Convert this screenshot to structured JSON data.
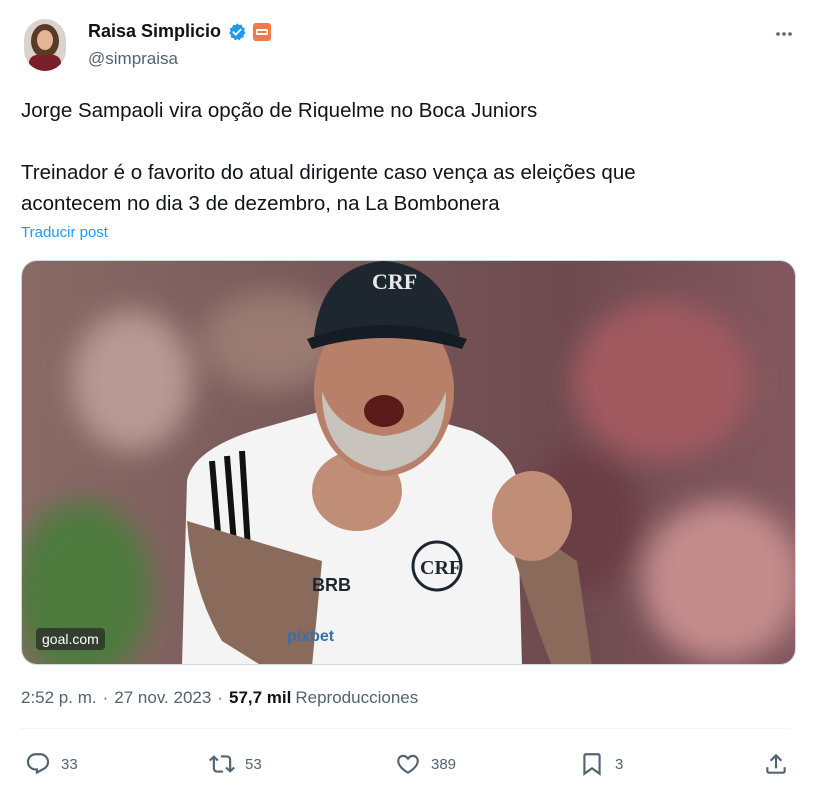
{
  "author": {
    "display_name": "Raisa Simplicio",
    "handle": "@simpraisa"
  },
  "icons": {
    "verified": "verified-badge-icon",
    "affiliation": "affiliation-badge-icon",
    "more": "more-icon",
    "reply": "reply-icon",
    "retweet": "retweet-icon",
    "like": "like-icon",
    "bookmark": "bookmark-icon",
    "share": "share-icon"
  },
  "colors": {
    "accent": "#1d9bf0",
    "secondary_text": "#536471",
    "primary_text": "#0f1419"
  },
  "tweet": {
    "line1": "Jorge Sampaoli vira opção de Riquelme no Boca Juniors",
    "line2": "Treinador é o favorito do atual dirigente caso vença as eleições que",
    "line3": "acontecem no dia 3 de dezembro, na La Bombonera",
    "translate_label": "Traducir post"
  },
  "media": {
    "watermark": "goal.com"
  },
  "meta": {
    "time": "2:52 p. m.",
    "date": "27 nov. 2023",
    "views_count": "57,7 mil",
    "views_label": "Reproducciones"
  },
  "actions": {
    "replies": "33",
    "retweets": "53",
    "likes": "389",
    "bookmarks": "3"
  }
}
